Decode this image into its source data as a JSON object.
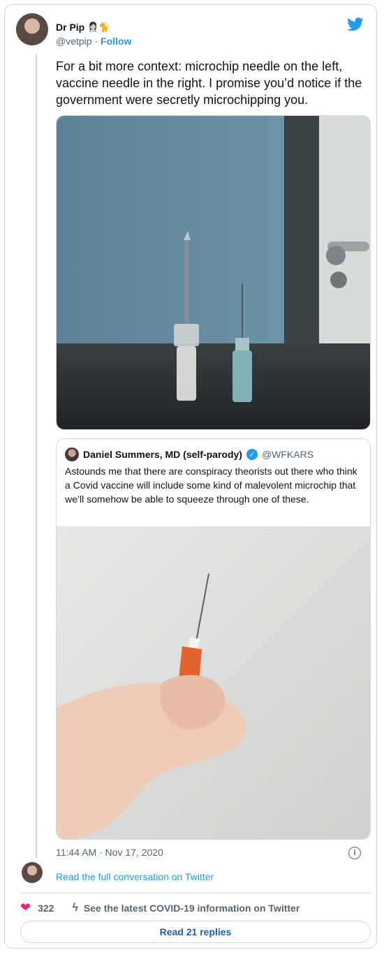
{
  "tweet": {
    "author_name": "Dr Pip",
    "author_emoji": "👩🏻‍⚕️🐈",
    "handle": "@vetpip",
    "separator": " · ",
    "follow_label": "Follow",
    "text": "For a bit more context: microchip needle on the left, vaccine needle in the right. I promise you’d notice if the government were secretly microchipping you.",
    "timestamp": "11:44 AM · Nov 17, 2020"
  },
  "quoted": {
    "author_name": "Daniel Summers, MD (self-parody)",
    "verified_mark": "✓",
    "handle": "@WFKARS",
    "text": "Astounds me that there are conspiracy theorists out there who think a Covid vaccine will include some kind of malevolent microchip that we’ll somehow be able to squeeze through one of these."
  },
  "footer": {
    "conversation_link": "Read the full conversation on Twitter",
    "likes": "322",
    "covid_info": "See the latest COVID-19 information on Twitter",
    "replies_button": "Read 21 replies",
    "info_glyph": "i"
  },
  "colors": {
    "twitter_blue": "#1d9bf0",
    "like_pink": "#f91880",
    "muted": "#536471"
  },
  "icons": [
    "twitter-bird-icon",
    "heart-icon",
    "lightning-icon",
    "info-icon",
    "verified-badge-icon"
  ]
}
